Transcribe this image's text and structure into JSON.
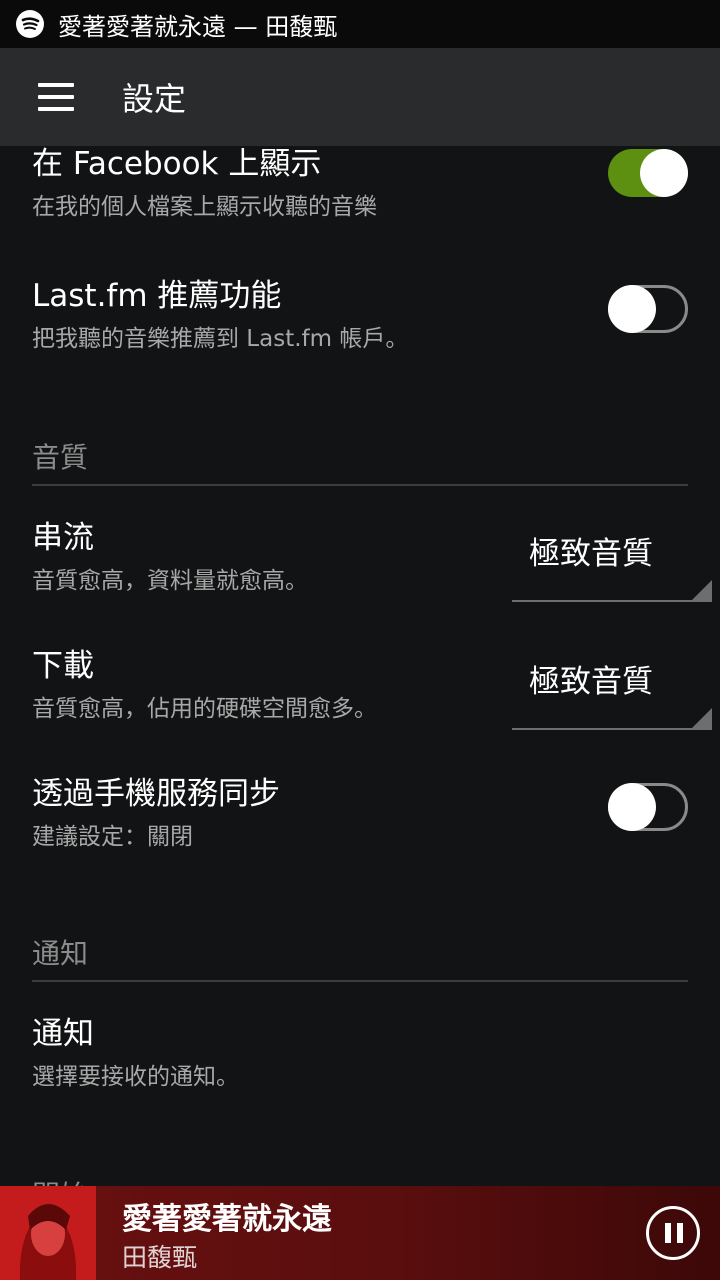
{
  "status_bar": {
    "now_playing": "愛著愛著就永遠 — 田馥甄",
    "app_icon": "spotify-icon"
  },
  "app_bar": {
    "menu_icon": "hamburger-menu-icon",
    "title": "設定"
  },
  "settings": {
    "facebook": {
      "label": "在 Facebook 上顯示",
      "sub": "在我的個人檔案上顯示收聽的音樂",
      "enabled": true
    },
    "lastfm": {
      "label": "Last.fm 推薦功能",
      "sub": "把我聽的音樂推薦到 Last.fm 帳戶。",
      "enabled": false
    },
    "audio_quality_header": "音質",
    "streaming": {
      "label": "串流",
      "sub": "音質愈高，資料量就愈高。",
      "value": "極致音質"
    },
    "download": {
      "label": "下載",
      "sub": "音質愈高，佔用的硬碟空間愈多。",
      "value": "極致音質"
    },
    "sync_mobile": {
      "label": "透過手機服務同步",
      "sub": "建議設定：關閉",
      "enabled": false
    },
    "notifications_header": "通知",
    "notifications": {
      "label": "通知",
      "sub": "選擇要接收的通知。"
    },
    "next_header_partial": "開始"
  },
  "player": {
    "track": "愛著愛著就永遠",
    "artist": "田馥甄",
    "pause_icon": "pause-icon"
  },
  "colors": {
    "toggle_on": "#5d8f10",
    "background": "#121314",
    "app_bar": "#2a2b2d",
    "player": "#5a0e0e"
  }
}
